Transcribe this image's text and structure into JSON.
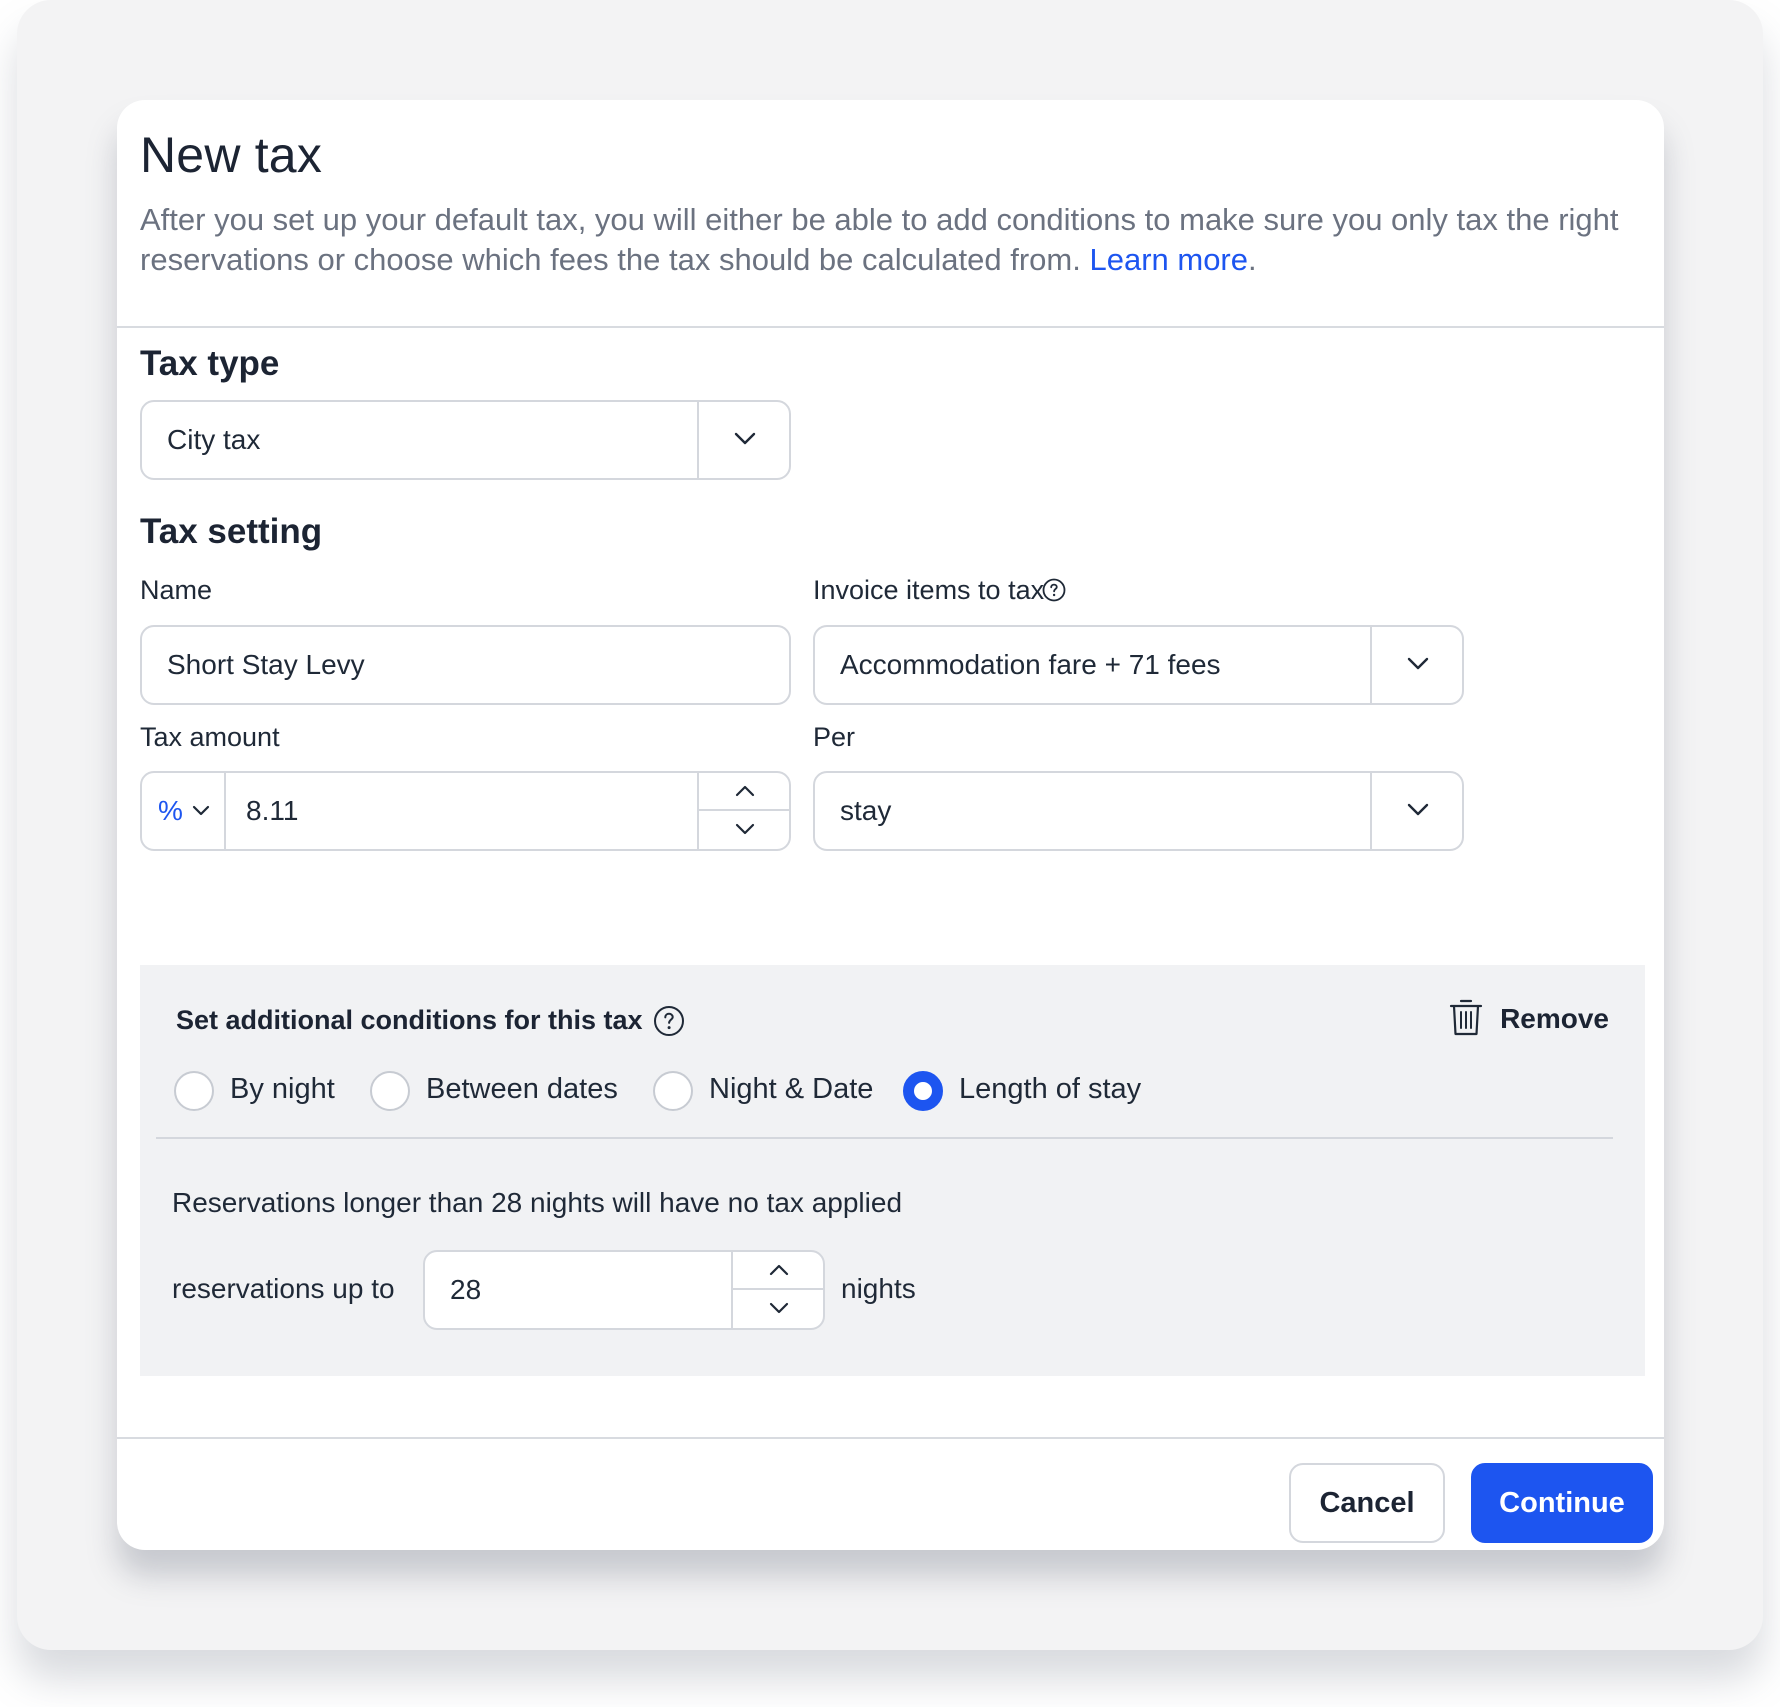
{
  "modal": {
    "title": "New tax",
    "description": "After you set up your default tax, you will either be able to add conditions to make sure you only tax the right reservations or choose which fees the tax should be calculated from.",
    "learn_more": "Learn more",
    "period": "."
  },
  "tax_type": {
    "heading": "Tax type",
    "selected": "City tax"
  },
  "tax_setting": {
    "heading": "Tax setting",
    "name_label": "Name",
    "name_value": "Short Stay Levy",
    "invoice_label": "Invoice items to tax",
    "invoice_value": "Accommodation fare + 71 fees",
    "amount_label": "Tax amount",
    "amount_unit": "%",
    "amount_value": "8.11",
    "per_label": "Per",
    "per_value": "stay"
  },
  "conditions": {
    "title": "Set additional conditions for this tax",
    "remove_label": "Remove",
    "options": [
      {
        "label": "By night",
        "selected": false
      },
      {
        "label": "Between dates",
        "selected": false
      },
      {
        "label": "Night & Date",
        "selected": false
      },
      {
        "label": "Length of stay",
        "selected": true
      }
    ],
    "note": "Reservations longer than 28 nights will have no tax applied",
    "upto_label": "reservations up to",
    "upto_value": "28",
    "nights_label": "nights"
  },
  "footer": {
    "cancel_label": "Cancel",
    "continue_label": "Continue"
  },
  "colors": {
    "accent": "#1d55f0",
    "panel_bg": "#f1f2f4",
    "border": "#d4d7dd"
  }
}
